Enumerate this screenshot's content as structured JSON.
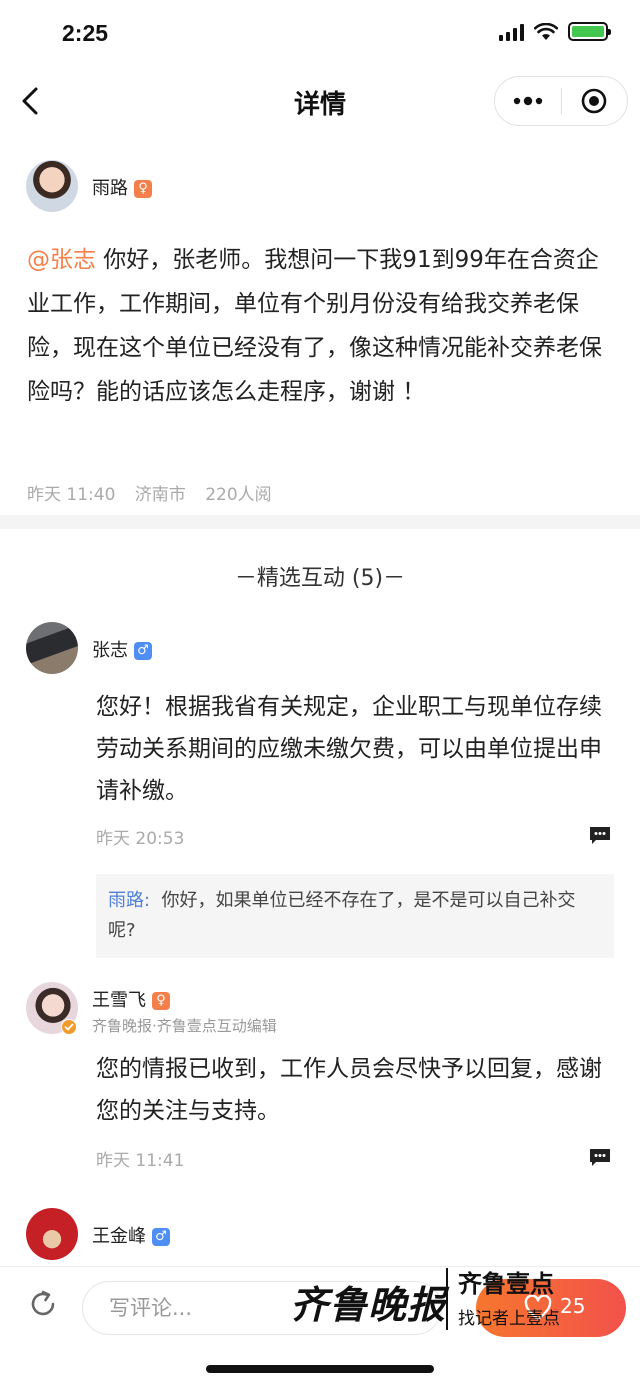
{
  "status_bar": {
    "time": "2:25"
  },
  "nav": {
    "title": "详情"
  },
  "question": {
    "author": "雨路",
    "author_gender": "♀",
    "mention": "@张志",
    "text": " 你好，张老师。我想问一下我91到99年在合资企业工作，工作期间，单位有个别月份没有给我交养老保险，现在这个单位已经没有了，像这种情况能补交养老保险吗？能的话应该怎么走程序，谢谢 ！",
    "time": "昨天 11:40",
    "location": "济南市",
    "views": "220人阅"
  },
  "section": {
    "title": "－精选互动 (5)－"
  },
  "comments": [
    {
      "author": "张志",
      "gender": "♂",
      "text": " 您好！根据我省有关规定，企业职工与现单位存续劳动关系期间的应缴未缴欠费，可以由单位提出申请补缴。",
      "time": "昨天 20:53",
      "reply": {
        "author": "雨路:",
        "text": "你好，如果单位已经不存在了，是不是可以自己补交呢?"
      }
    },
    {
      "author": "王雪飞",
      "gender": "♀",
      "subtitle": "齐鲁晚报·齐鲁壹点互动编辑",
      "text": " 您的情报已收到，工作人员会尽快予以回复，感谢您的关注与支持。",
      "time": "昨天 11:41"
    },
    {
      "author": "王金峰",
      "gender": "♂"
    }
  ],
  "bottom_bar": {
    "comment_placeholder": "写评论...",
    "like_count": "25"
  },
  "watermark": {
    "brand": "齐鲁晚报",
    "name": "齐鲁壹点",
    "slogan": "找记者上壹点"
  },
  "colors": {
    "accent": "#f57f4a",
    "male": "#4f8ff5",
    "link": "#4f7fd6"
  }
}
